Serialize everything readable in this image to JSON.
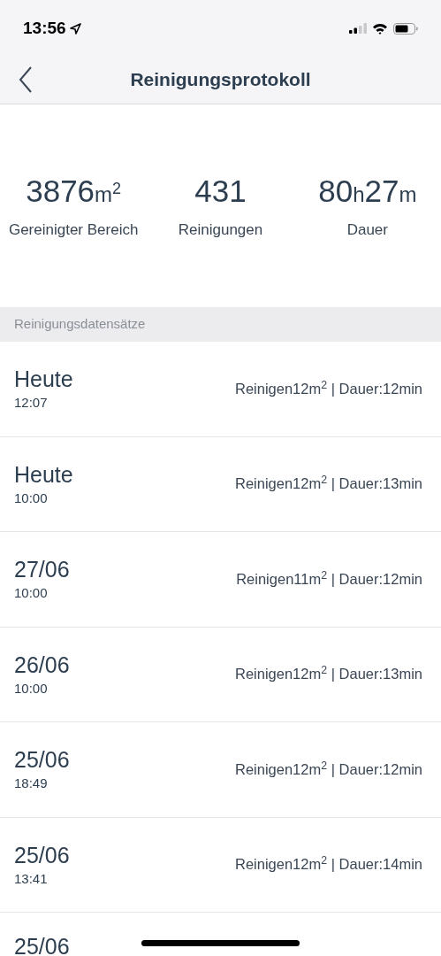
{
  "status_bar": {
    "time": "13:56"
  },
  "nav": {
    "title": "Reinigungsprotokoll"
  },
  "stats": [
    {
      "parts": [
        {
          "kind": "number",
          "text": "3876"
        },
        {
          "kind": "unit",
          "text": "m$^{2}$"
        }
      ],
      "label": "Gereinigter Bereich"
    },
    {
      "parts": [
        {
          "kind": "number",
          "text": "431"
        }
      ],
      "label": "Reinigungen"
    },
    {
      "parts": [
        {
          "kind": "number",
          "text": "80"
        },
        {
          "kind": "unit",
          "text": "h"
        },
        {
          "kind": "number",
          "text": "27"
        },
        {
          "kind": "unit",
          "text": "m"
        }
      ],
      "label": "Dauer"
    }
  ],
  "section_header": "Reinigungsdatensätze",
  "records": [
    {
      "date": "Heute",
      "time": "12:07",
      "summary": "Reinigen12m$^{2}$ | Dauer:12min"
    },
    {
      "date": "Heute",
      "time": "10:00",
      "summary": "Reinigen12m$^{2}$ | Dauer:13min"
    },
    {
      "date": "27/06",
      "time": "10:00",
      "summary": "Reinigen11m$^{2}$ | Dauer:12min"
    },
    {
      "date": "26/06",
      "time": "10:00",
      "summary": "Reinigen12m$^{2}$ | Dauer:13min"
    },
    {
      "date": "25/06",
      "time": "18:49",
      "summary": "Reinigen12m$^{2}$ | Dauer:12min"
    },
    {
      "date": "25/06",
      "time": "13:41",
      "summary": "Reinigen12m$^{2}$ | Dauer:14min"
    },
    {
      "date": "25/06"
    }
  ]
}
